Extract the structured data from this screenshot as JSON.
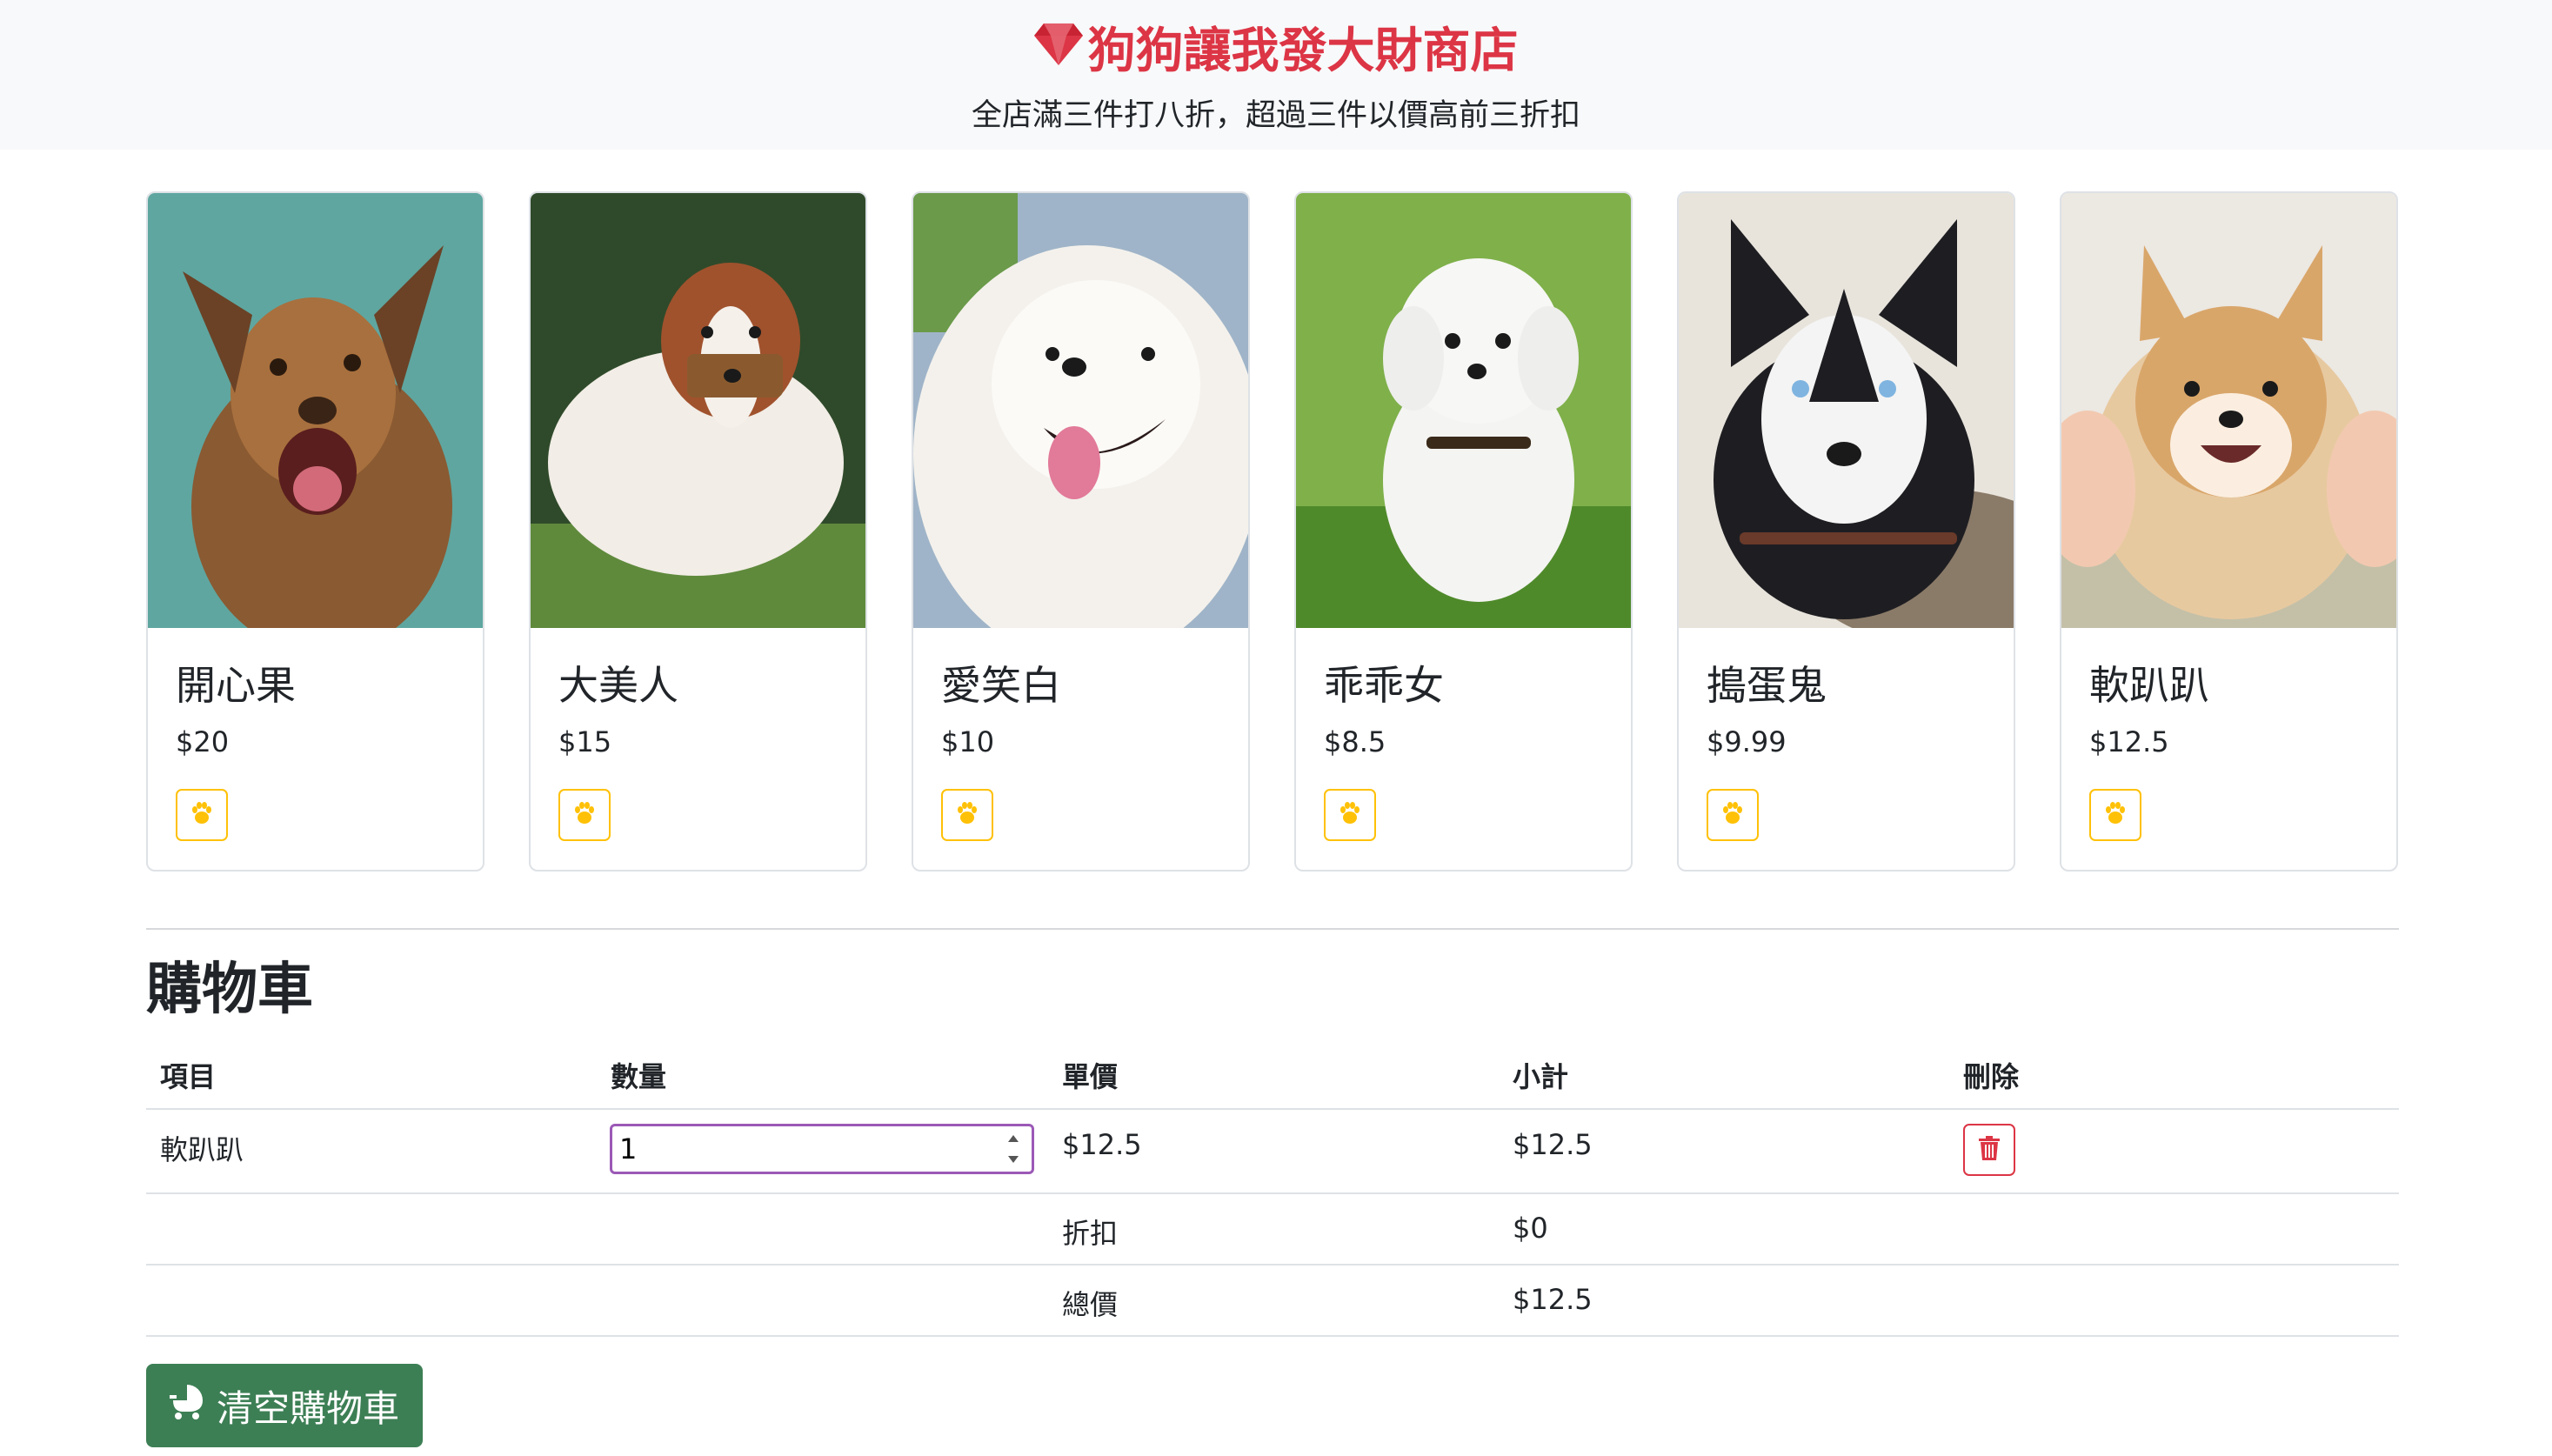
{
  "header": {
    "title": "狗狗讓我發大財商店",
    "subtitle": "全店滿三件打八折，超過三件以價高前三折扣",
    "title_color": "#dc3545",
    "title_icon": "gem-icon"
  },
  "products": [
    {
      "name": "開心果",
      "price": "$20",
      "button_icon": "paw-icon"
    },
    {
      "name": "大美人",
      "price": "$15",
      "button_icon": "paw-icon"
    },
    {
      "name": "愛笑白",
      "price": "$10",
      "button_icon": "paw-icon"
    },
    {
      "name": "乖乖女",
      "price": "$8.5",
      "button_icon": "paw-icon"
    },
    {
      "name": "搗蛋鬼",
      "price": "$9.99",
      "button_icon": "paw-icon"
    },
    {
      "name": "軟趴趴",
      "price": "$12.5",
      "button_icon": "paw-icon"
    }
  ],
  "cart": {
    "title": "購物車",
    "headers": [
      "項目",
      "數量",
      "單價",
      "小計",
      "刪除"
    ],
    "items": [
      {
        "name": "軟趴趴",
        "quantity": "1",
        "unit_price": "$12.5",
        "subtotal": "$12.5",
        "delete_icon": "trash-icon"
      }
    ],
    "discount_label": "折扣",
    "discount_value": "$0",
    "total_label": "總價",
    "total_value": "$12.5",
    "clear_label": "清空購物車",
    "clear_icon": "baby-carriage-icon",
    "clear_color": "#3d7f55"
  }
}
